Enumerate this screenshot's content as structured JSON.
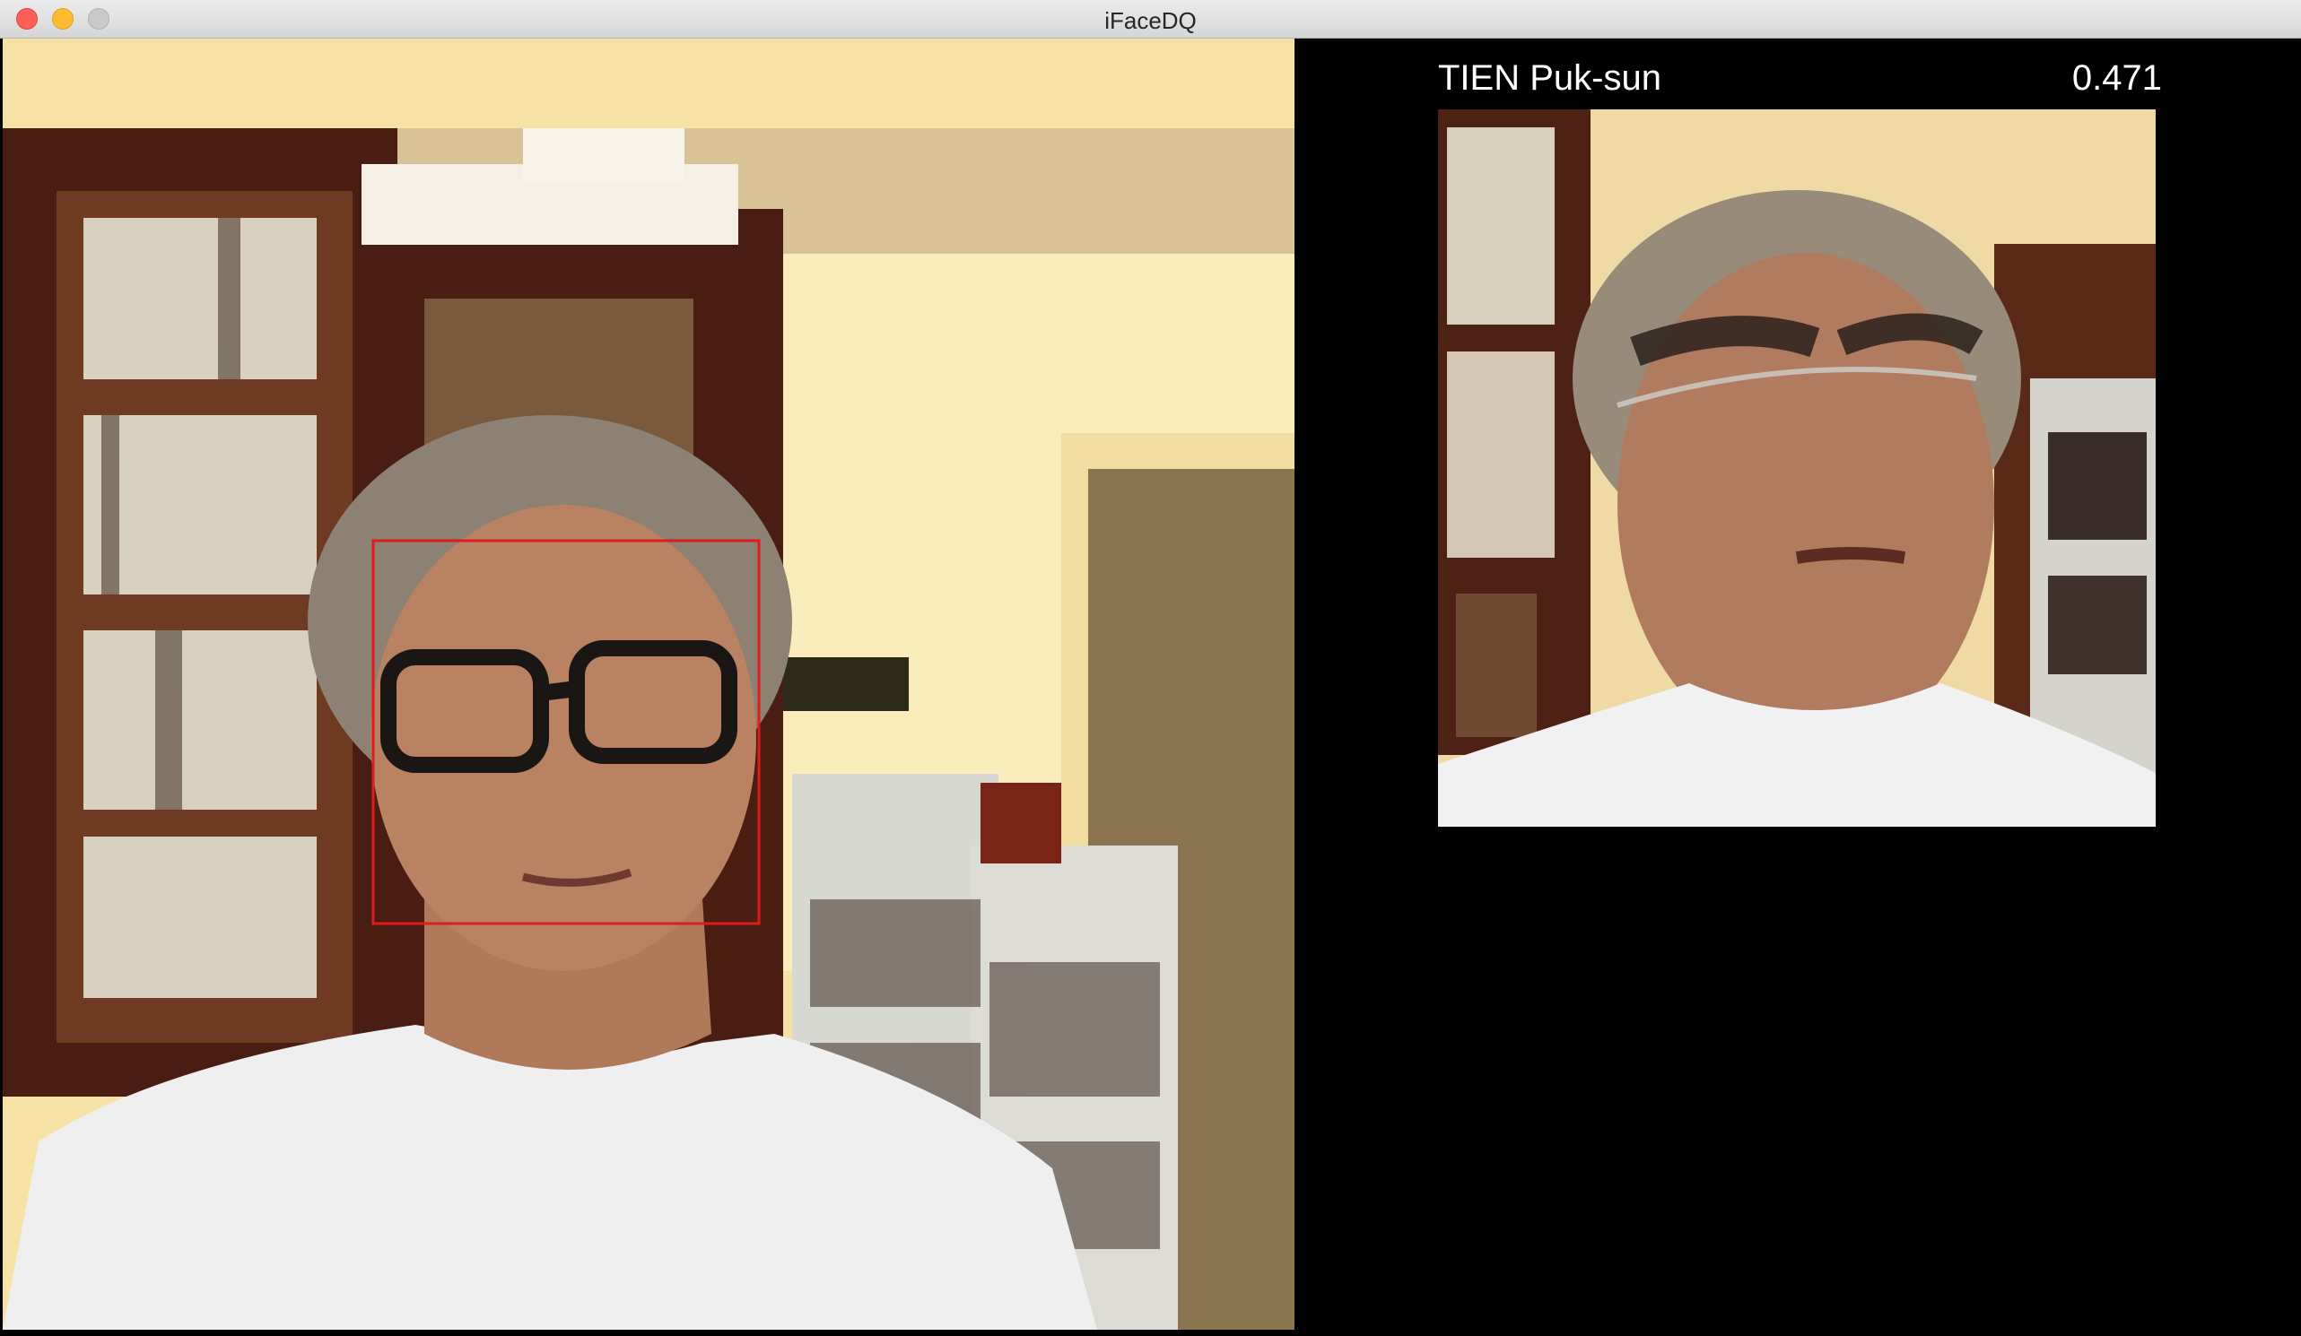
{
  "window": {
    "title": "iFaceDQ"
  },
  "match": {
    "name": "TIEN Puk-sun",
    "score": "0.471"
  },
  "detection": {
    "box_color": "#e01b1b"
  }
}
